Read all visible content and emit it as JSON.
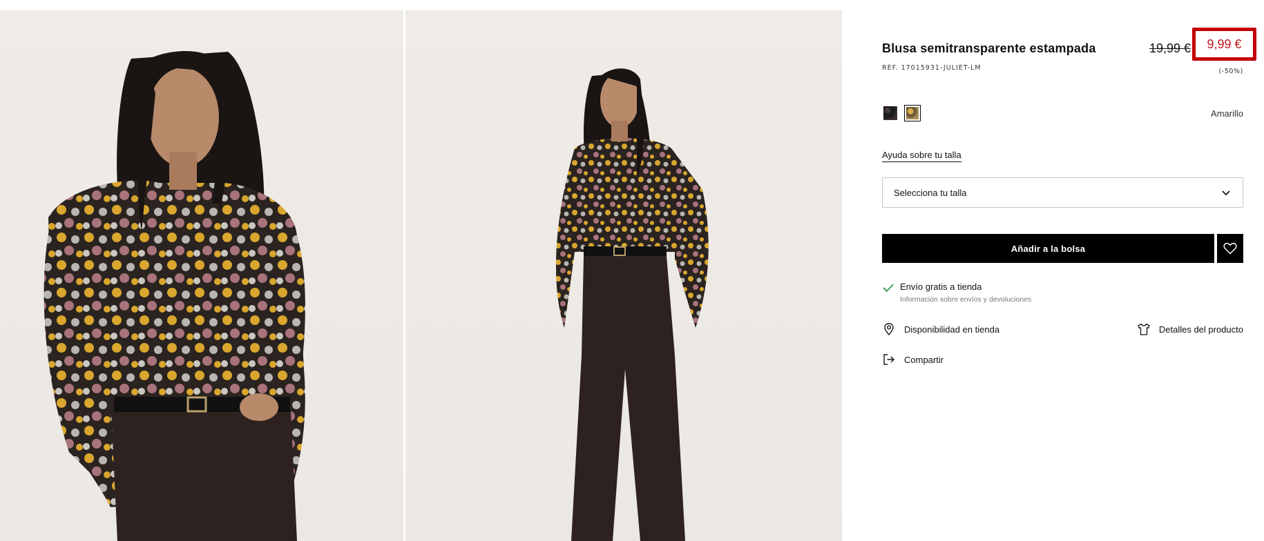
{
  "product": {
    "title": "Blusa semitransparente estampada",
    "ref": "REF. 17015931-JULIET-LM",
    "old_price": "19,99 €",
    "new_price": "9,99 €",
    "discount": "(-50%)",
    "color_name": "Amarillo",
    "colors": {
      "accent_sale": "#c4161c",
      "highlight_box": "#c10000",
      "button_bg": "#000000"
    }
  },
  "size": {
    "help_link": "Ayuda sobre tu talla",
    "select_placeholder": "Selecciona tu talla"
  },
  "actions": {
    "add_to_bag": "Añadir a la bolsa"
  },
  "shipping": {
    "title": "Envío gratis a tienda",
    "subtitle": "Información sobre envíos y devoluciones"
  },
  "links": {
    "store_availability": "Disponibilidad en tienda",
    "product_details": "Detalles del producto",
    "share": "Compartir"
  }
}
